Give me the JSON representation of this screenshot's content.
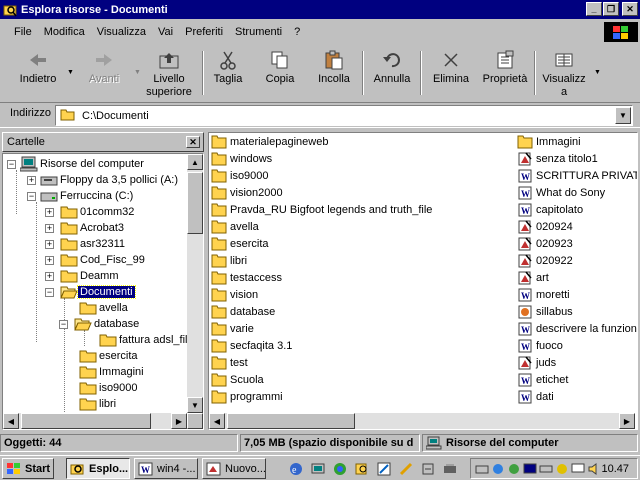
{
  "window": {
    "title": "Esplora risorse - Documenti"
  },
  "menu": [
    "File",
    "Modifica",
    "Visualizza",
    "Vai",
    "Preferiti",
    "Strumenti",
    "?"
  ],
  "toolbar": {
    "back": "Indietro",
    "forward": "Avanti",
    "up_1": "Livello",
    "up_2": "superiore",
    "cut": "Taglia",
    "copy": "Copia",
    "paste": "Incolla",
    "undo": "Annulla",
    "delete": "Elimina",
    "properties": "Proprietà",
    "views_1": "Visualizz",
    "views_2": "a"
  },
  "address": {
    "label": "Indirizzo",
    "value": "C:\\Documenti"
  },
  "tree": {
    "header": "Cartelle",
    "items": [
      "Risorse del computer",
      "Floppy da 3,5 pollici (A:)",
      "Ferruccina (C:)",
      "01comm32",
      "Acrobat3",
      "asr32311",
      "Cod_Fisc_99",
      "Deamm",
      "Documenti",
      "avella",
      "database",
      "fattura adsl_file",
      "esercita",
      "Immagini",
      "iso9000",
      "libri"
    ]
  },
  "files": {
    "col1": [
      "materialepagineweb",
      "windows",
      "iso9000",
      "vision2000",
      "Pravda_RU Bigfoot legends and truth_file",
      "avella",
      "esercita",
      "libri",
      "testaccess",
      "vision",
      "database",
      "varie",
      "secfaqita 3.1",
      "test",
      "Scuola",
      "programmi"
    ],
    "col2": [
      "Immagini",
      "senza titolo1",
      "SCRITTURA PRIVATA",
      "What do Sony",
      "capitolato",
      "020924",
      "020923",
      "020922",
      "art",
      "moretti",
      "sillabus",
      "descrivere la funzione",
      "fuoco",
      "juds",
      "etichet",
      "dati"
    ]
  },
  "status": {
    "objects": "Oggetti: 44",
    "space": "7,05 MB (spazio disponibile su d",
    "location": "Risorse del computer"
  },
  "taskbar": {
    "start": "Start",
    "tasks": [
      "Esplo...",
      "win4 -...",
      "Nuovo..."
    ],
    "clock": "10.47"
  }
}
